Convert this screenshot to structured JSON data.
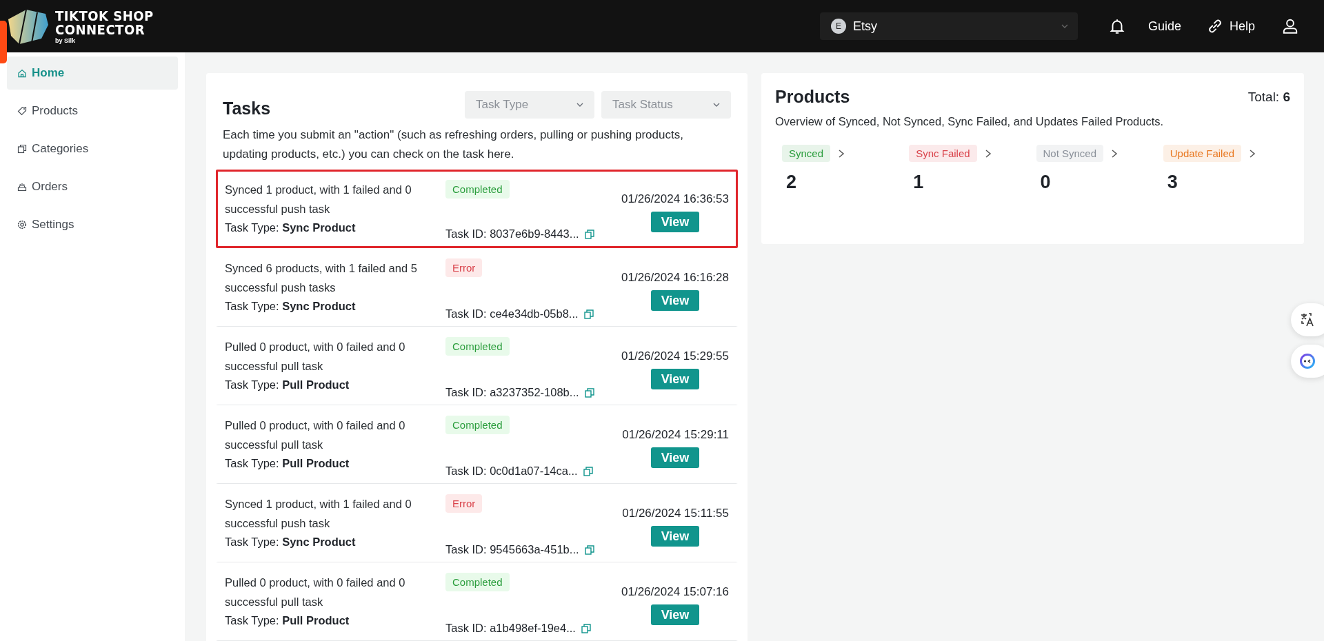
{
  "header": {
    "logo": {
      "line1": "TIKTOK SHOP",
      "line2": "CONNECTOR",
      "byline": "by Silk"
    },
    "store_select": {
      "avatar": "E",
      "value": "Etsy"
    },
    "links": [
      {
        "kind": "bell"
      },
      {
        "kind": "text",
        "label": "Guide"
      },
      {
        "kind": "link",
        "label": "Help"
      },
      {
        "kind": "user"
      }
    ]
  },
  "sidebar": {
    "items": [
      {
        "label": "Home",
        "selected": true
      },
      {
        "label": "Products",
        "selected": false
      },
      {
        "label": "Categories",
        "selected": false
      },
      {
        "label": "Orders",
        "selected": false
      },
      {
        "label": "Settings",
        "selected": false
      }
    ]
  },
  "tasks": {
    "title": "Tasks",
    "filters": [
      {
        "placeholder": "Task Type"
      },
      {
        "placeholder": "Task Status"
      }
    ],
    "description": "Each time you submit an \"action\" (such as refreshing orders, pulling or pushing products, updating products, etc.) you can check on the task here.",
    "rows": [
      {
        "summary": "Synced 1 product, with 1 failed and 0 successful push task",
        "status": "Completed",
        "kind": "success",
        "type_label": "Task Type:",
        "type": "Sync Product",
        "task_id": "Task ID: 8037e6b9-8443...",
        "time": "01/26/2024 16:36:53",
        "action": "View",
        "highlighted": true
      },
      {
        "summary": "Synced 6 products, with 1 failed and 5 successful push tasks",
        "status": "Error",
        "kind": "error",
        "type_label": "Task Type:",
        "type": "Sync Product",
        "task_id": "Task ID: ce4e34db-05b8...",
        "time": "01/26/2024 16:16:28",
        "action": "View",
        "highlighted": false
      },
      {
        "summary": "Pulled 0 product, with 0 failed and 0 successful pull task",
        "status": "Completed",
        "kind": "success",
        "type_label": "Task Type:",
        "type": "Pull Product",
        "task_id": "Task ID: a3237352-108b...",
        "time": "01/26/2024 15:29:55",
        "action": "View",
        "highlighted": false
      },
      {
        "summary": "Pulled 0 product, with 0 failed and 0 successful pull task",
        "status": "Completed",
        "kind": "success",
        "type_label": "Task Type:",
        "type": "Pull Product",
        "task_id": "Task ID: 0c0d1a07-14ca...",
        "time": "01/26/2024 15:29:11",
        "action": "View",
        "highlighted": false
      },
      {
        "summary": "Synced 1 product, with 1 failed and 0 successful push task",
        "status": "Error",
        "kind": "error",
        "type_label": "Task Type:",
        "type": "Sync Product",
        "task_id": "Task ID: 9545663a-451b...",
        "time": "01/26/2024 15:11:55",
        "action": "View",
        "highlighted": false
      },
      {
        "summary": "Pulled 0 product, with 0 failed and 0 successful pull task",
        "status": "Completed",
        "kind": "success",
        "type_label": "Task Type:",
        "type": "Pull Product",
        "task_id": "Task ID: a1b498ef-19e4...",
        "time": "01/26/2024 15:07:16",
        "action": "View",
        "highlighted": false
      }
    ]
  },
  "products": {
    "title": "Products",
    "total_label": "Total:",
    "total": "6",
    "description": "Overview of Synced, Not Synced, Sync Failed, and Updates Failed Products.",
    "stats": [
      {
        "label": "Synced",
        "count": "2",
        "color": "#2a9d3c"
      },
      {
        "label": "Sync Failed",
        "count": "1",
        "color": "#d9424a"
      },
      {
        "label": "Not Synced",
        "count": "0",
        "color": "#8a9099"
      },
      {
        "label": "Update Failed",
        "count": "3",
        "color": "#e8771f"
      }
    ]
  }
}
